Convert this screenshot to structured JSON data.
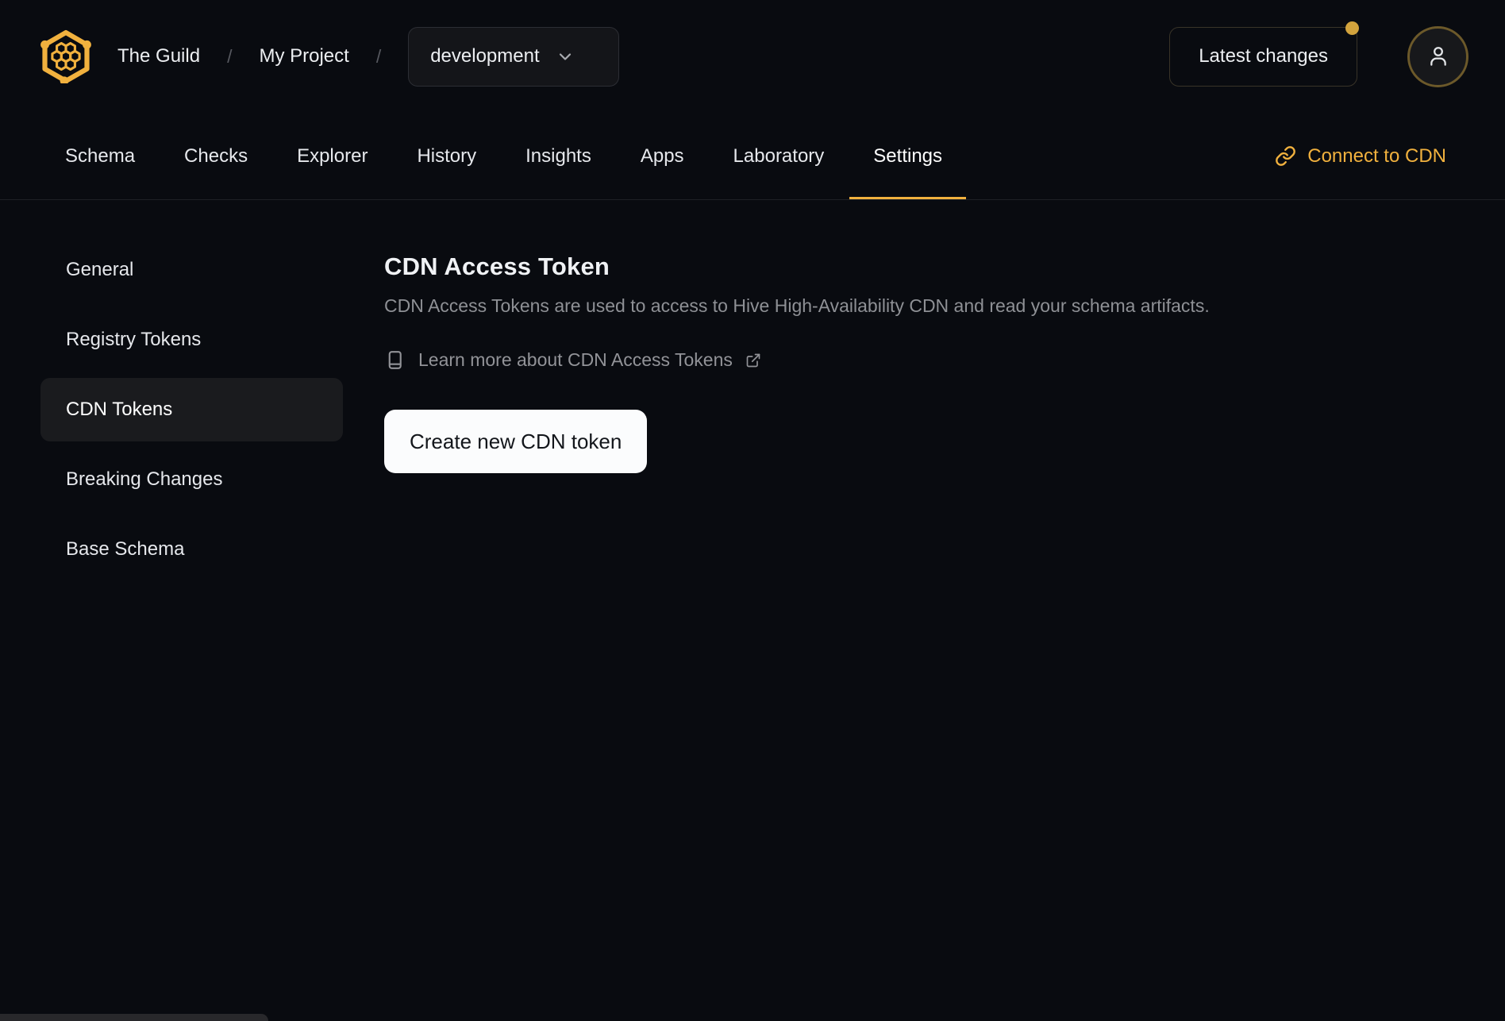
{
  "header": {
    "org": "The Guild",
    "separator": "/",
    "project": "My Project",
    "target": "development",
    "latest_changes_label": "Latest changes"
  },
  "tabs": {
    "items": [
      {
        "label": "Schema"
      },
      {
        "label": "Checks"
      },
      {
        "label": "Explorer"
      },
      {
        "label": "History"
      },
      {
        "label": "Insights"
      },
      {
        "label": "Apps"
      },
      {
        "label": "Laboratory"
      },
      {
        "label": "Settings"
      }
    ],
    "active_tab": "Settings",
    "connect_cdn_label": "Connect to CDN"
  },
  "sidebar": {
    "items": [
      {
        "label": "General"
      },
      {
        "label": "Registry Tokens"
      },
      {
        "label": "CDN Tokens"
      },
      {
        "label": "Breaking Changes"
      },
      {
        "label": "Base Schema"
      }
    ],
    "active_item": "CDN Tokens"
  },
  "main": {
    "title": "CDN Access Token",
    "description": "CDN Access Tokens are used to access to Hive High-Availability CDN and read your schema artifacts.",
    "learn_more_label": "Learn more about CDN Access Tokens",
    "create_token_label": "Create new CDN token"
  },
  "icons": {
    "logo": "hive-honeycomb-hexagon",
    "chevron": "chevron-down",
    "connect": "chain-link",
    "learn_more": "book",
    "external": "external-link",
    "avatar": "person",
    "notification": "gold-dot"
  },
  "colors": {
    "background": "#090b10",
    "accent_gold": "#f1b13e",
    "notification_dot": "#d2a33d",
    "active_tab_underline": "#f1b13e",
    "sidebar_active_bg": "#1a1b1e",
    "create_button_bg": "#fbfcfd",
    "muted_text": "#8e9095"
  }
}
